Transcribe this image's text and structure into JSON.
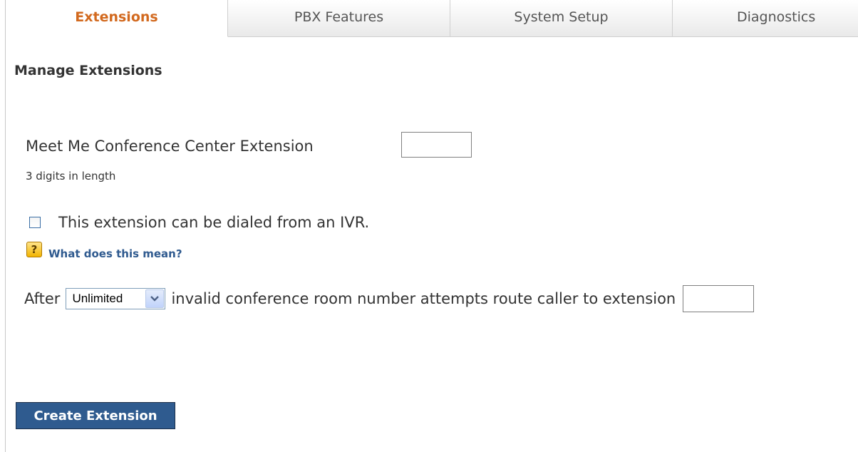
{
  "tabs": [
    {
      "label": "Extensions",
      "active": true
    },
    {
      "label": "PBX Features",
      "active": false
    },
    {
      "label": "System Setup",
      "active": false
    },
    {
      "label": "Diagnostics",
      "active": false
    }
  ],
  "page": {
    "title": "Manage Extensions"
  },
  "form": {
    "extension_label": "Meet Me Conference Center Extension",
    "extension_value": "",
    "extension_hint": "3 digits in length",
    "ivr_checkbox_label": "This extension can be dialed from an IVR.",
    "ivr_checked": false,
    "help_icon_glyph": "?",
    "help_link": "What does this mean?",
    "route_prefix": "After",
    "attempts_selected": "Unlimited",
    "route_suffix": "invalid conference room number attempts route caller to extension",
    "route_extension_value": ""
  },
  "actions": {
    "create_button": "Create Extension"
  },
  "colors": {
    "active_tab": "#d2691e",
    "link": "#2f5a8f",
    "button_bg": "#2f5b8f"
  }
}
